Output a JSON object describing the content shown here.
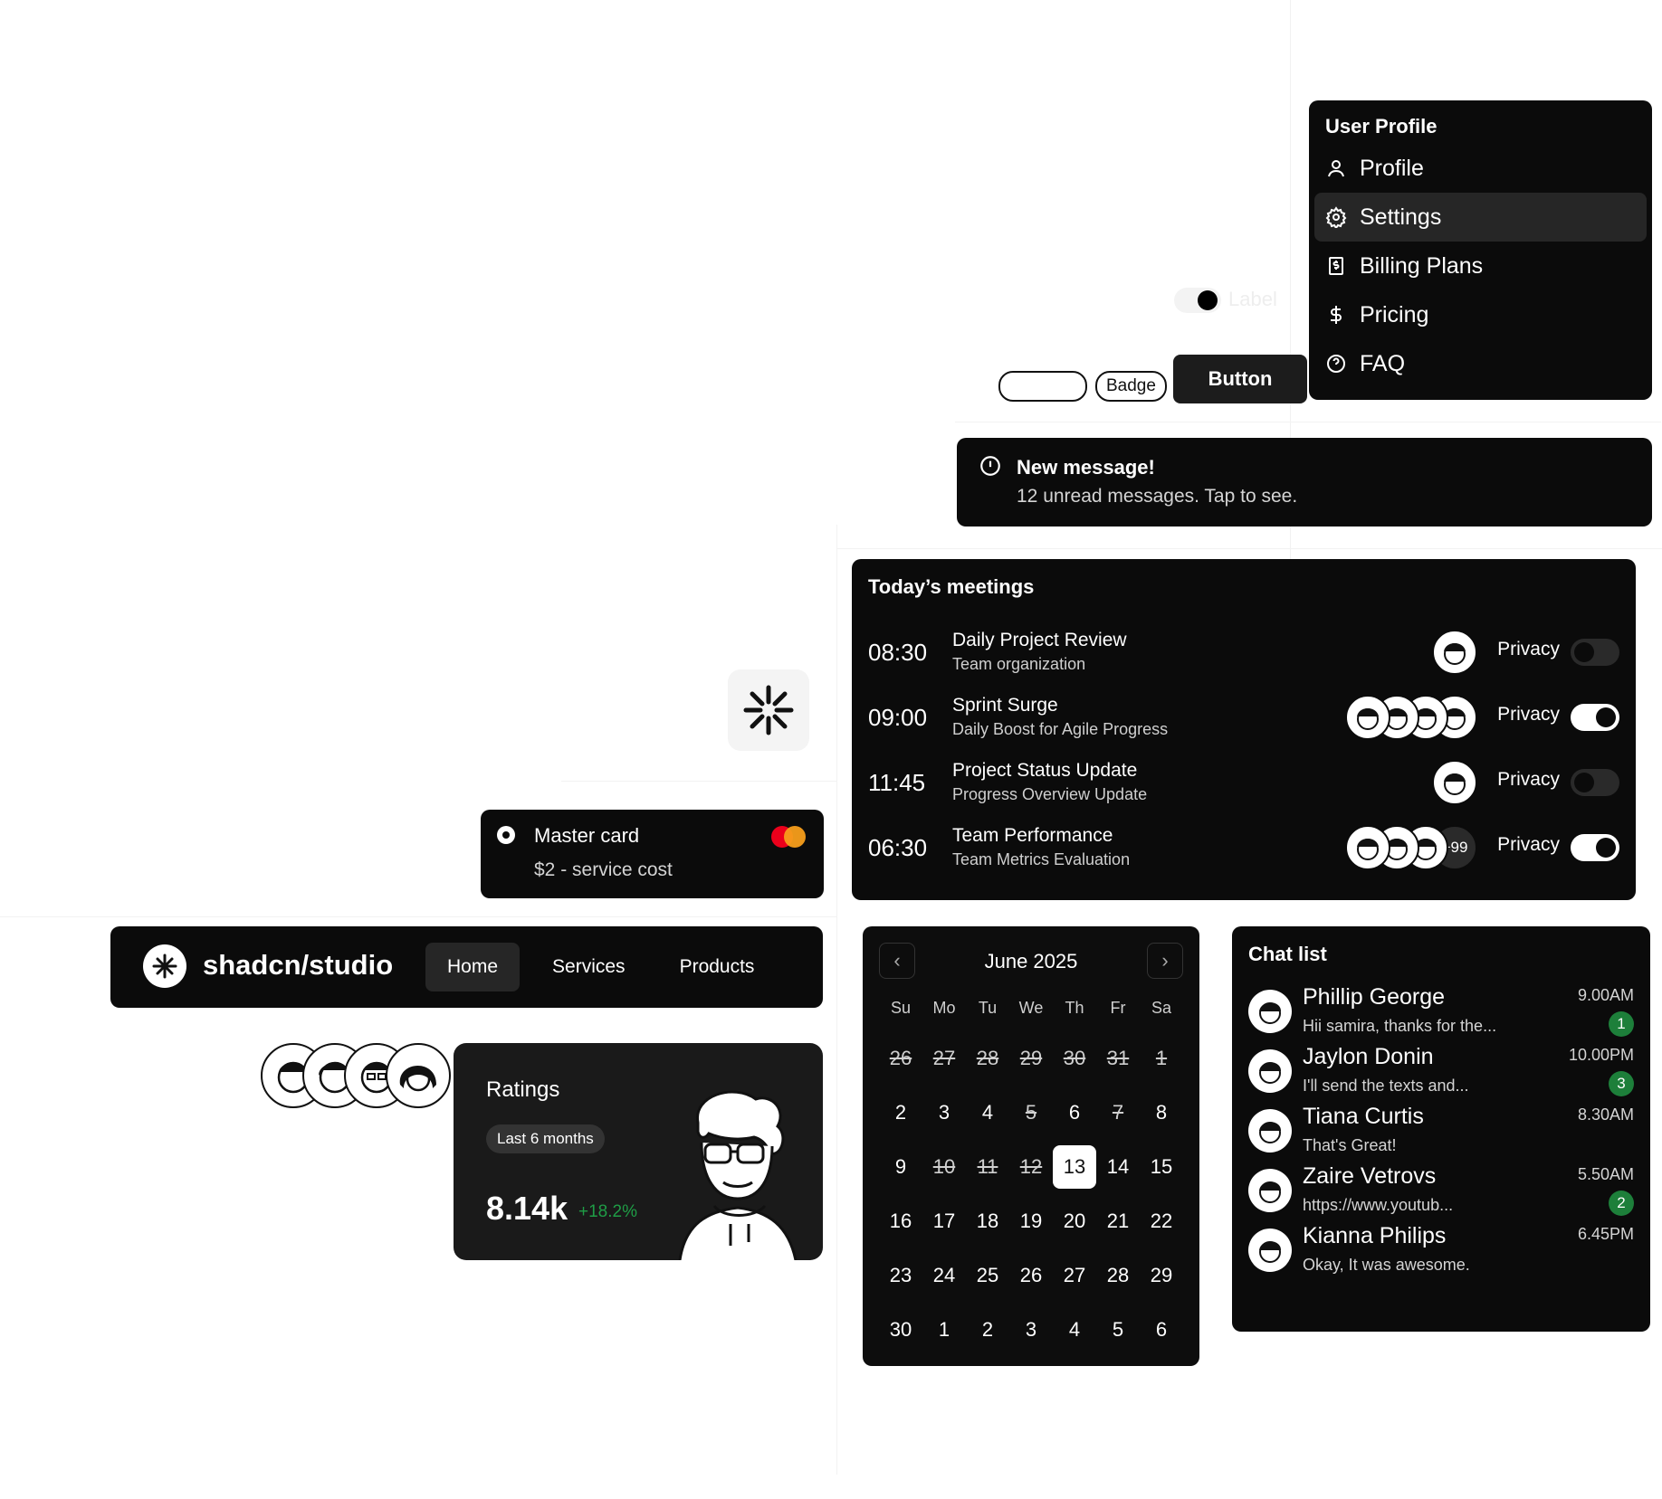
{
  "profile_menu": {
    "title": "User Profile",
    "items": [
      {
        "label": "Profile",
        "icon": "user-icon"
      },
      {
        "label": "Settings",
        "icon": "gear-icon",
        "active": true
      },
      {
        "label": "Billing Plans",
        "icon": "receipt-dollar-icon"
      },
      {
        "label": "Pricing",
        "icon": "dollar-icon"
      },
      {
        "label": "FAQ",
        "icon": "help-circle-icon"
      }
    ]
  },
  "mini_switch": {
    "label": "Label",
    "on": true
  },
  "badges": {
    "badge_label": "Badge",
    "button_label": "Button"
  },
  "alert": {
    "title": "New message!",
    "description": "12 unread messages. Tap to see.",
    "icon": "alert-circle-icon"
  },
  "meetings": {
    "title": "Today’s meetings",
    "rows": [
      {
        "time": "08:30",
        "name": "Daily Project Review",
        "sub": "Team organization",
        "privacy": "Privacy",
        "toggle_on": false,
        "avatars": 1,
        "more": ""
      },
      {
        "time": "09:00",
        "name": "Sprint Surge",
        "sub": "Daily Boost for Agile Progress",
        "privacy": "Privacy",
        "toggle_on": true,
        "avatars": 4,
        "more": ""
      },
      {
        "time": "11:45",
        "name": "Project Status Update",
        "sub": "Progress Overview Update",
        "privacy": "Privacy",
        "toggle_on": false,
        "avatars": 1,
        "more": ""
      },
      {
        "time": "06:30",
        "name": "Team Performance",
        "sub": "Team Metrics Evaluation",
        "privacy": "Privacy",
        "toggle_on": true,
        "avatars": 3,
        "more": "+99"
      }
    ]
  },
  "mastercard": {
    "title": "Master card",
    "cost": "$2 - service cost",
    "selected": true
  },
  "navbar": {
    "brand": "shadcn/studio",
    "links": [
      {
        "label": "Home",
        "active": true
      },
      {
        "label": "Services"
      },
      {
        "label": "Products"
      }
    ]
  },
  "ratings": {
    "title": "Ratings",
    "period": "Last 6 months",
    "value": "8.14k",
    "delta": "+18.2%"
  },
  "calendar": {
    "month": "June 2025",
    "prev_icon": "chevron-left-icon",
    "next_icon": "chevron-right-icon",
    "weekdays": [
      "Su",
      "Mo",
      "Tu",
      "We",
      "Th",
      "Fr",
      "Sa"
    ],
    "days": [
      {
        "d": "26",
        "s": true
      },
      {
        "d": "27",
        "s": true
      },
      {
        "d": "28",
        "s": true
      },
      {
        "d": "29",
        "s": true
      },
      {
        "d": "30",
        "s": true
      },
      {
        "d": "31",
        "s": true
      },
      {
        "d": "1",
        "s": true
      },
      {
        "d": "2"
      },
      {
        "d": "3"
      },
      {
        "d": "4"
      },
      {
        "d": "5",
        "s": true
      },
      {
        "d": "6"
      },
      {
        "d": "7",
        "s": true
      },
      {
        "d": "8"
      },
      {
        "d": "9"
      },
      {
        "d": "10",
        "s": true
      },
      {
        "d": "11",
        "s": true
      },
      {
        "d": "12",
        "s": true
      },
      {
        "d": "13",
        "sel": true
      },
      {
        "d": "14"
      },
      {
        "d": "15"
      },
      {
        "d": "16"
      },
      {
        "d": "17"
      },
      {
        "d": "18"
      },
      {
        "d": "19"
      },
      {
        "d": "20"
      },
      {
        "d": "21"
      },
      {
        "d": "22"
      },
      {
        "d": "23"
      },
      {
        "d": "24"
      },
      {
        "d": "25"
      },
      {
        "d": "26"
      },
      {
        "d": "27"
      },
      {
        "d": "28"
      },
      {
        "d": "29"
      },
      {
        "d": "30"
      },
      {
        "d": "1"
      },
      {
        "d": "2"
      },
      {
        "d": "3"
      },
      {
        "d": "4"
      },
      {
        "d": "5"
      },
      {
        "d": "6"
      }
    ]
  },
  "chat": {
    "title": "Chat list",
    "rows": [
      {
        "name": "Phillip George",
        "msg": "Hii samira, thanks for the...",
        "time": "9.00AM",
        "count": "1"
      },
      {
        "name": "Jaylon Donin",
        "msg": "I'll send the texts and...",
        "time": "10.00PM",
        "count": "3"
      },
      {
        "name": "Tiana Curtis",
        "msg": "That's Great!",
        "time": "8.30AM",
        "count": ""
      },
      {
        "name": "Zaire Vetrovs",
        "msg": "https://www.youtub...",
        "time": "5.50AM",
        "count": "2"
      },
      {
        "name": "Kianna Philips",
        "msg": "Okay, It was awesome.",
        "time": "6.45PM",
        "count": ""
      }
    ]
  }
}
